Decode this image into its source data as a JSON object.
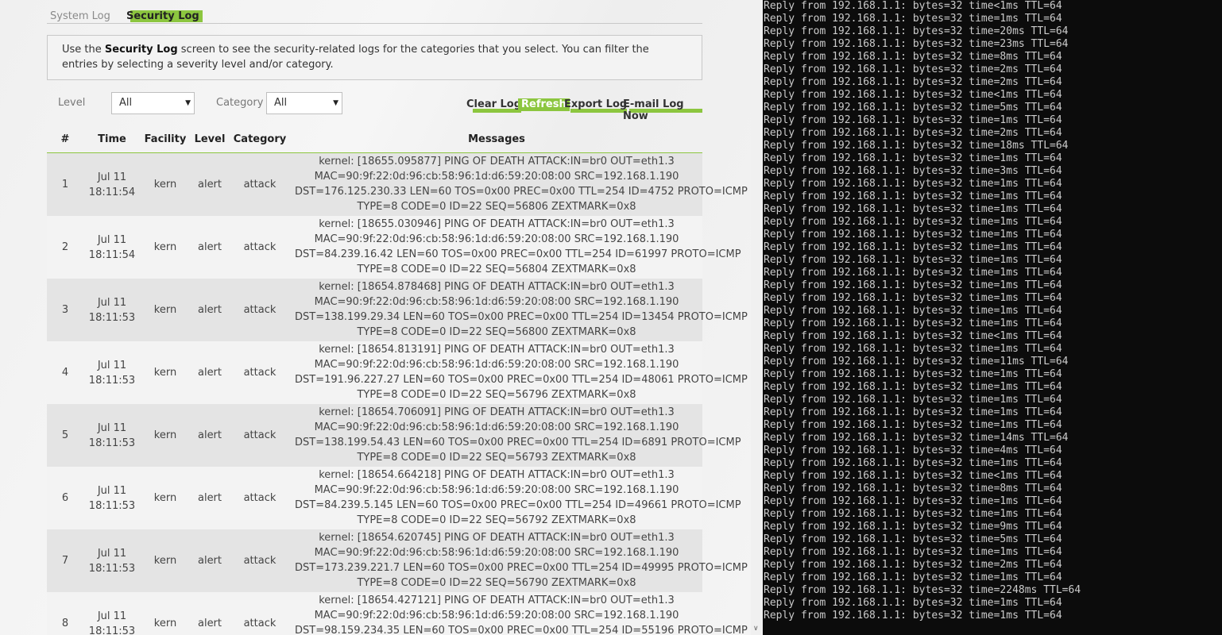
{
  "tabs": {
    "system_log": "System Log",
    "security_log": "Security Log"
  },
  "info": {
    "pre": "Use the ",
    "bold": "Security Log",
    "post": " screen to see the security-related logs for the categories that you select. You can filter the entries by selecting a severity level and/or category."
  },
  "filters": {
    "level_label": "Level",
    "level_value": "All",
    "category_label": "Category",
    "category_value": "All"
  },
  "actions": {
    "clear": "Clear Log",
    "refresh": "Refresh",
    "export": "Export Log",
    "email": "E-mail Log Now"
  },
  "table": {
    "headers": {
      "num": "#",
      "time": "Time",
      "facility": "Facility",
      "level": "Level",
      "category": "Category",
      "messages": "Messages"
    },
    "rows": [
      {
        "num": "1",
        "date": "Jul 11",
        "time": "18:11:54",
        "facility": "kern",
        "level": "alert",
        "category": "attack",
        "msg": [
          "kernel: [18655.095877] PING OF DEATH ATTACK:IN=br0 OUT=eth1.3",
          "MAC=90:9f:22:0d:96:cb:58:96:1d:d6:59:20:08:00 SRC=192.168.1.190",
          "DST=176.125.230.33 LEN=60 TOS=0x00 PREC=0x00 TTL=254 ID=4752 PROTO=ICMP",
          "TYPE=8 CODE=0 ID=22 SEQ=56806 ZEXTMARK=0x8"
        ]
      },
      {
        "num": "2",
        "date": "Jul 11",
        "time": "18:11:54",
        "facility": "kern",
        "level": "alert",
        "category": "attack",
        "msg": [
          "kernel: [18655.030946] PING OF DEATH ATTACK:IN=br0 OUT=eth1.3",
          "MAC=90:9f:22:0d:96:cb:58:96:1d:d6:59:20:08:00 SRC=192.168.1.190",
          "DST=84.239.16.42 LEN=60 TOS=0x00 PREC=0x00 TTL=254 ID=61997 PROTO=ICMP",
          "TYPE=8 CODE=0 ID=22 SEQ=56804 ZEXTMARK=0x8"
        ]
      },
      {
        "num": "3",
        "date": "Jul 11",
        "time": "18:11:53",
        "facility": "kern",
        "level": "alert",
        "category": "attack",
        "msg": [
          "kernel: [18654.878468] PING OF DEATH ATTACK:IN=br0 OUT=eth1.3",
          "MAC=90:9f:22:0d:96:cb:58:96:1d:d6:59:20:08:00 SRC=192.168.1.190",
          "DST=138.199.29.34 LEN=60 TOS=0x00 PREC=0x00 TTL=254 ID=13454 PROTO=ICMP",
          "TYPE=8 CODE=0 ID=22 SEQ=56800 ZEXTMARK=0x8"
        ]
      },
      {
        "num": "4",
        "date": "Jul 11",
        "time": "18:11:53",
        "facility": "kern",
        "level": "alert",
        "category": "attack",
        "msg": [
          "kernel: [18654.813191] PING OF DEATH ATTACK:IN=br0 OUT=eth1.3",
          "MAC=90:9f:22:0d:96:cb:58:96:1d:d6:59:20:08:00 SRC=192.168.1.190",
          "DST=191.96.227.27 LEN=60 TOS=0x00 PREC=0x00 TTL=254 ID=48061 PROTO=ICMP",
          "TYPE=8 CODE=0 ID=22 SEQ=56796 ZEXTMARK=0x8"
        ]
      },
      {
        "num": "5",
        "date": "Jul 11",
        "time": "18:11:53",
        "facility": "kern",
        "level": "alert",
        "category": "attack",
        "msg": [
          "kernel: [18654.706091] PING OF DEATH ATTACK:IN=br0 OUT=eth1.3",
          "MAC=90:9f:22:0d:96:cb:58:96:1d:d6:59:20:08:00 SRC=192.168.1.190",
          "DST=138.199.54.43 LEN=60 TOS=0x00 PREC=0x00 TTL=254 ID=6891 PROTO=ICMP",
          "TYPE=8 CODE=0 ID=22 SEQ=56793 ZEXTMARK=0x8"
        ]
      },
      {
        "num": "6",
        "date": "Jul 11",
        "time": "18:11:53",
        "facility": "kern",
        "level": "alert",
        "category": "attack",
        "msg": [
          "kernel: [18654.664218] PING OF DEATH ATTACK:IN=br0 OUT=eth1.3",
          "MAC=90:9f:22:0d:96:cb:58:96:1d:d6:59:20:08:00 SRC=192.168.1.190",
          "DST=84.239.5.145 LEN=60 TOS=0x00 PREC=0x00 TTL=254 ID=49661 PROTO=ICMP",
          "TYPE=8 CODE=0 ID=22 SEQ=56792 ZEXTMARK=0x8"
        ]
      },
      {
        "num": "7",
        "date": "Jul 11",
        "time": "18:11:53",
        "facility": "kern",
        "level": "alert",
        "category": "attack",
        "msg": [
          "kernel: [18654.620745] PING OF DEATH ATTACK:IN=br0 OUT=eth1.3",
          "MAC=90:9f:22:0d:96:cb:58:96:1d:d6:59:20:08:00 SRC=192.168.1.190",
          "DST=173.239.221.7 LEN=60 TOS=0x00 PREC=0x00 TTL=254 ID=49995 PROTO=ICMP",
          "TYPE=8 CODE=0 ID=22 SEQ=56790 ZEXTMARK=0x8"
        ]
      },
      {
        "num": "8",
        "date": "Jul 11",
        "time": "18:11:53",
        "facility": "kern",
        "level": "alert",
        "category": "attack",
        "msg": [
          "kernel: [18654.427121] PING OF DEATH ATTACK:IN=br0 OUT=eth1.3",
          "MAC=90:9f:22:0d:96:cb:58:96:1d:d6:59:20:08:00 SRC=192.168.1.190",
          "DST=98.159.234.35 LEN=60 TOS=0x00 PREC=0x00 TTL=254 ID=55196 PROTO=ICMP"
        ]
      }
    ]
  },
  "terminal": {
    "lines": [
      "Reply from 192.168.1.1: bytes=32 time<1ms TTL=64",
      "Reply from 192.168.1.1: bytes=32 time=1ms TTL=64",
      "Reply from 192.168.1.1: bytes=32 time=20ms TTL=64",
      "Reply from 192.168.1.1: bytes=32 time=23ms TTL=64",
      "Reply from 192.168.1.1: bytes=32 time=8ms TTL=64",
      "Reply from 192.168.1.1: bytes=32 time=2ms TTL=64",
      "Reply from 192.168.1.1: bytes=32 time=2ms TTL=64",
      "Reply from 192.168.1.1: bytes=32 time<1ms TTL=64",
      "Reply from 192.168.1.1: bytes=32 time=5ms TTL=64",
      "Reply from 192.168.1.1: bytes=32 time=1ms TTL=64",
      "Reply from 192.168.1.1: bytes=32 time=2ms TTL=64",
      "Reply from 192.168.1.1: bytes=32 time=18ms TTL=64",
      "Reply from 192.168.1.1: bytes=32 time=1ms TTL=64",
      "Reply from 192.168.1.1: bytes=32 time=3ms TTL=64",
      "Reply from 192.168.1.1: bytes=32 time=1ms TTL=64",
      "Reply from 192.168.1.1: bytes=32 time=1ms TTL=64",
      "Reply from 192.168.1.1: bytes=32 time=1ms TTL=64",
      "Reply from 192.168.1.1: bytes=32 time=1ms TTL=64",
      "Reply from 192.168.1.1: bytes=32 time=1ms TTL=64",
      "Reply from 192.168.1.1: bytes=32 time=1ms TTL=64",
      "Reply from 192.168.1.1: bytes=32 time=1ms TTL=64",
      "Reply from 192.168.1.1: bytes=32 time=1ms TTL=64",
      "Reply from 192.168.1.1: bytes=32 time=1ms TTL=64",
      "Reply from 192.168.1.1: bytes=32 time=1ms TTL=64",
      "Reply from 192.168.1.1: bytes=32 time=1ms TTL=64",
      "Reply from 192.168.1.1: bytes=32 time=1ms TTL=64",
      "Reply from 192.168.1.1: bytes=32 time<1ms TTL=64",
      "Reply from 192.168.1.1: bytes=32 time=1ms TTL=64",
      "Reply from 192.168.1.1: bytes=32 time=11ms TTL=64",
      "Reply from 192.168.1.1: bytes=32 time=1ms TTL=64",
      "Reply from 192.168.1.1: bytes=32 time=1ms TTL=64",
      "Reply from 192.168.1.1: bytes=32 time=1ms TTL=64",
      "Reply from 192.168.1.1: bytes=32 time=1ms TTL=64",
      "Reply from 192.168.1.1: bytes=32 time=1ms TTL=64",
      "Reply from 192.168.1.1: bytes=32 time=14ms TTL=64",
      "Reply from 192.168.1.1: bytes=32 time=4ms TTL=64",
      "Reply from 192.168.1.1: bytes=32 time=1ms TTL=64",
      "Reply from 192.168.1.1: bytes=32 time<1ms TTL=64",
      "Reply from 192.168.1.1: bytes=32 time=8ms TTL=64",
      "Reply from 192.168.1.1: bytes=32 time=1ms TTL=64",
      "Reply from 192.168.1.1: bytes=32 time=1ms TTL=64",
      "Reply from 192.168.1.1: bytes=32 time=9ms TTL=64",
      "Reply from 192.168.1.1: bytes=32 time=5ms TTL=64",
      "Reply from 192.168.1.1: bytes=32 time=1ms TTL=64",
      "Reply from 192.168.1.1: bytes=32 time=2ms TTL=64",
      "Reply from 192.168.1.1: bytes=32 time=1ms TTL=64",
      "Reply from 192.168.1.1: bytes=32 time=2248ms TTL=64",
      "Reply from 192.168.1.1: bytes=32 time=1ms TTL=64",
      "Reply from 192.168.1.1: bytes=32 time=1ms TTL=64"
    ]
  },
  "scrollbar": {
    "arrow_icon": "chevron-down-icon"
  }
}
